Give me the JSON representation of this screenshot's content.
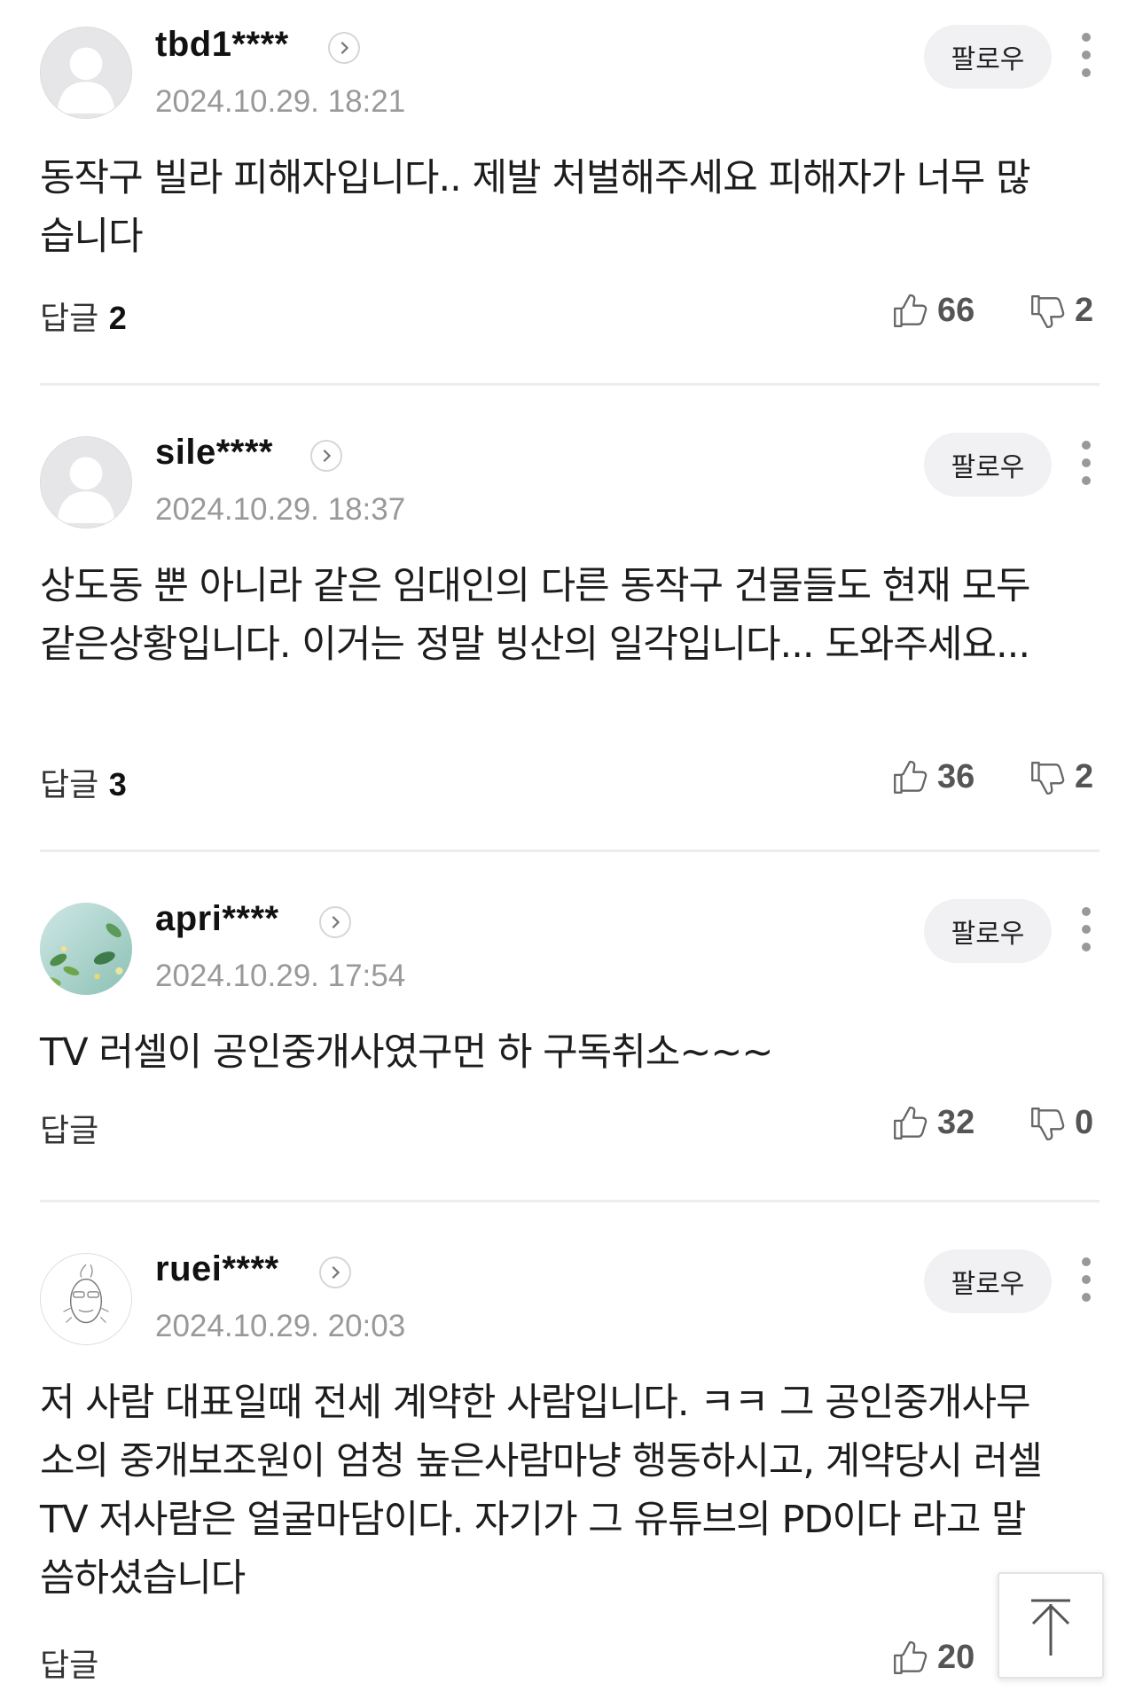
{
  "follow_label": "팔로우",
  "comments": [
    {
      "username": "tbd1****",
      "date": "2024.10.29. 18:21",
      "body": "동작구 빌라 피해자입니다.. 제발 처벌해주세요 피해자가 너무 많습니다",
      "reply_label": "답글",
      "reply_count": "2",
      "likes": "66",
      "dislikes": "2",
      "avatar": "default-avatar-icon"
    },
    {
      "username": "sile****",
      "date": "2024.10.29. 18:37",
      "body": "상도동 뿐 아니라 같은 임대인의 다른 동작구 건물들도 현재 모두 같은상황입니다. 이거는 정말 빙산의 일각입니다... 도와주세요...",
      "reply_label": "답글",
      "reply_count": "3",
      "likes": "36",
      "dislikes": "2",
      "avatar": "default-avatar-icon"
    },
    {
      "username": "apri****",
      "date": "2024.10.29. 17:54",
      "body": "TV 러셀이 공인중개사였구먼 하 구독취소~~~",
      "reply_label": "답글",
      "reply_count": "",
      "likes": "32",
      "dislikes": "0",
      "avatar": "leaves-photo-avatar"
    },
    {
      "username": "ruei****",
      "date": "2024.10.29. 20:03",
      "body": "저 사람 대표일때 전세 계약한 사람입니다. ㅋㅋ 그 공인중개사무소의 중개보조원이 엄청 높은사람마냥 행동하시고, 계약당시 러셀TV 저사람은 얼굴마담이다. 자기가 그 유튜브의 PD이다 라고 말씀하셨습니다",
      "reply_label": "답글",
      "reply_count": "",
      "likes": "20",
      "dislikes": "",
      "avatar": "doodle-face-avatar"
    }
  ],
  "icons": {
    "like": "thumbs-up-icon",
    "dislike": "thumbs-down-icon",
    "more": "more-vertical-icon",
    "profile_link": "chevron-right-icon",
    "scroll_top": "arrow-up-icon"
  }
}
